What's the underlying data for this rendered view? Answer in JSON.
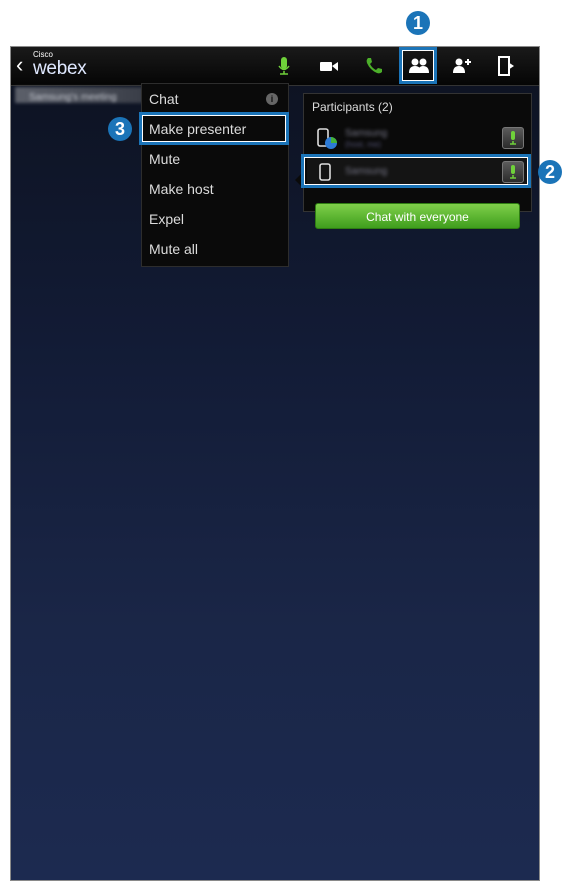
{
  "header": {
    "back": "‹",
    "logo_small": "Cisco",
    "logo_main": "webex",
    "icons": [
      "mic-icon",
      "video-icon",
      "phone-icon",
      "participants-icon",
      "add-participant-icon",
      "exit-icon"
    ]
  },
  "meeting_strip": {
    "label": "Samsung's meeting"
  },
  "menu": {
    "items": [
      {
        "label": "Chat"
      },
      {
        "label": "Make presenter"
      },
      {
        "label": "Mute"
      },
      {
        "label": "Make host"
      },
      {
        "label": "Expel"
      },
      {
        "label": "Mute all"
      }
    ],
    "info": "i"
  },
  "participants": {
    "title": "Participants (2)",
    "rows": [
      {
        "name": "Samsung",
        "sub": "(host, me)"
      },
      {
        "name": "Samsung",
        "sub": ""
      }
    ],
    "chat_button": "Chat with everyone"
  },
  "callouts": [
    "1",
    "2",
    "3"
  ],
  "colors": {
    "highlight": "#1b74b8",
    "green": "#4caf2a"
  }
}
